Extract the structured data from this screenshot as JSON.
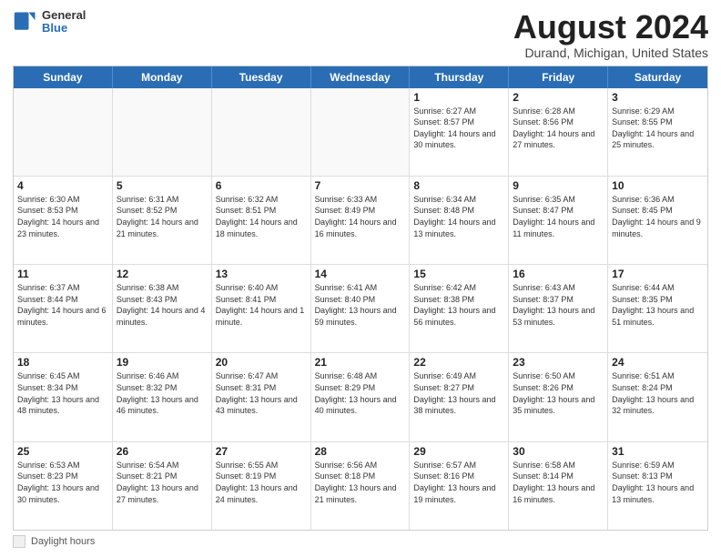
{
  "logo": {
    "general": "General",
    "blue": "Blue"
  },
  "title": "August 2024",
  "subtitle": "Durand, Michigan, United States",
  "days_of_week": [
    "Sunday",
    "Monday",
    "Tuesday",
    "Wednesday",
    "Thursday",
    "Friday",
    "Saturday"
  ],
  "weeks": [
    [
      {
        "day": "",
        "text": ""
      },
      {
        "day": "",
        "text": ""
      },
      {
        "day": "",
        "text": ""
      },
      {
        "day": "",
        "text": ""
      },
      {
        "day": "1",
        "text": "Sunrise: 6:27 AM\nSunset: 8:57 PM\nDaylight: 14 hours and 30 minutes."
      },
      {
        "day": "2",
        "text": "Sunrise: 6:28 AM\nSunset: 8:56 PM\nDaylight: 14 hours and 27 minutes."
      },
      {
        "day": "3",
        "text": "Sunrise: 6:29 AM\nSunset: 8:55 PM\nDaylight: 14 hours and 25 minutes."
      }
    ],
    [
      {
        "day": "4",
        "text": "Sunrise: 6:30 AM\nSunset: 8:53 PM\nDaylight: 14 hours and 23 minutes."
      },
      {
        "day": "5",
        "text": "Sunrise: 6:31 AM\nSunset: 8:52 PM\nDaylight: 14 hours and 21 minutes."
      },
      {
        "day": "6",
        "text": "Sunrise: 6:32 AM\nSunset: 8:51 PM\nDaylight: 14 hours and 18 minutes."
      },
      {
        "day": "7",
        "text": "Sunrise: 6:33 AM\nSunset: 8:49 PM\nDaylight: 14 hours and 16 minutes."
      },
      {
        "day": "8",
        "text": "Sunrise: 6:34 AM\nSunset: 8:48 PM\nDaylight: 14 hours and 13 minutes."
      },
      {
        "day": "9",
        "text": "Sunrise: 6:35 AM\nSunset: 8:47 PM\nDaylight: 14 hours and 11 minutes."
      },
      {
        "day": "10",
        "text": "Sunrise: 6:36 AM\nSunset: 8:45 PM\nDaylight: 14 hours and 9 minutes."
      }
    ],
    [
      {
        "day": "11",
        "text": "Sunrise: 6:37 AM\nSunset: 8:44 PM\nDaylight: 14 hours and 6 minutes."
      },
      {
        "day": "12",
        "text": "Sunrise: 6:38 AM\nSunset: 8:43 PM\nDaylight: 14 hours and 4 minutes."
      },
      {
        "day": "13",
        "text": "Sunrise: 6:40 AM\nSunset: 8:41 PM\nDaylight: 14 hours and 1 minute."
      },
      {
        "day": "14",
        "text": "Sunrise: 6:41 AM\nSunset: 8:40 PM\nDaylight: 13 hours and 59 minutes."
      },
      {
        "day": "15",
        "text": "Sunrise: 6:42 AM\nSunset: 8:38 PM\nDaylight: 13 hours and 56 minutes."
      },
      {
        "day": "16",
        "text": "Sunrise: 6:43 AM\nSunset: 8:37 PM\nDaylight: 13 hours and 53 minutes."
      },
      {
        "day": "17",
        "text": "Sunrise: 6:44 AM\nSunset: 8:35 PM\nDaylight: 13 hours and 51 minutes."
      }
    ],
    [
      {
        "day": "18",
        "text": "Sunrise: 6:45 AM\nSunset: 8:34 PM\nDaylight: 13 hours and 48 minutes."
      },
      {
        "day": "19",
        "text": "Sunrise: 6:46 AM\nSunset: 8:32 PM\nDaylight: 13 hours and 46 minutes."
      },
      {
        "day": "20",
        "text": "Sunrise: 6:47 AM\nSunset: 8:31 PM\nDaylight: 13 hours and 43 minutes."
      },
      {
        "day": "21",
        "text": "Sunrise: 6:48 AM\nSunset: 8:29 PM\nDaylight: 13 hours and 40 minutes."
      },
      {
        "day": "22",
        "text": "Sunrise: 6:49 AM\nSunset: 8:27 PM\nDaylight: 13 hours and 38 minutes."
      },
      {
        "day": "23",
        "text": "Sunrise: 6:50 AM\nSunset: 8:26 PM\nDaylight: 13 hours and 35 minutes."
      },
      {
        "day": "24",
        "text": "Sunrise: 6:51 AM\nSunset: 8:24 PM\nDaylight: 13 hours and 32 minutes."
      }
    ],
    [
      {
        "day": "25",
        "text": "Sunrise: 6:53 AM\nSunset: 8:23 PM\nDaylight: 13 hours and 30 minutes."
      },
      {
        "day": "26",
        "text": "Sunrise: 6:54 AM\nSunset: 8:21 PM\nDaylight: 13 hours and 27 minutes."
      },
      {
        "day": "27",
        "text": "Sunrise: 6:55 AM\nSunset: 8:19 PM\nDaylight: 13 hours and 24 minutes."
      },
      {
        "day": "28",
        "text": "Sunrise: 6:56 AM\nSunset: 8:18 PM\nDaylight: 13 hours and 21 minutes."
      },
      {
        "day": "29",
        "text": "Sunrise: 6:57 AM\nSunset: 8:16 PM\nDaylight: 13 hours and 19 minutes."
      },
      {
        "day": "30",
        "text": "Sunrise: 6:58 AM\nSunset: 8:14 PM\nDaylight: 13 hours and 16 minutes."
      },
      {
        "day": "31",
        "text": "Sunrise: 6:59 AM\nSunset: 8:13 PM\nDaylight: 13 hours and 13 minutes."
      }
    ]
  ],
  "legend": {
    "box_label": "Daylight hours"
  }
}
